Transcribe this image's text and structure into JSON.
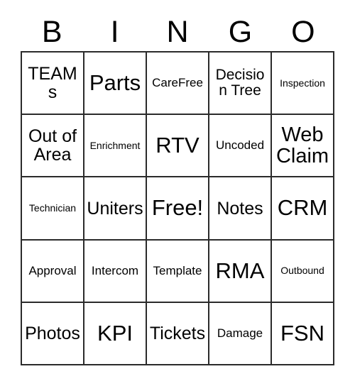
{
  "card": {
    "title": "BINGO",
    "header": {
      "letters": [
        "B",
        "I",
        "N",
        "G",
        "O"
      ]
    },
    "free_space_label": "Free!",
    "colors": {
      "background": "#ffffff",
      "border": "#2b2b2b",
      "text": "#000000"
    },
    "grid": {
      "rows": 5,
      "columns": 5,
      "cells": [
        [
          {
            "label": "TEAMs",
            "size": "l"
          },
          {
            "label": "Parts",
            "size": "xxl"
          },
          {
            "label": "CareFree",
            "size": "s"
          },
          {
            "label": "Decision Tree",
            "size": "m"
          },
          {
            "label": "Inspection",
            "size": "xs"
          }
        ],
        [
          {
            "label": "Out of Area",
            "size": "l"
          },
          {
            "label": "Enrichment",
            "size": "xs"
          },
          {
            "label": "RTV",
            "size": "xxl"
          },
          {
            "label": "Uncoded",
            "size": "s"
          },
          {
            "label": "Web Claim",
            "size": "xl"
          }
        ],
        [
          {
            "label": "Technician",
            "size": "xs"
          },
          {
            "label": "Uniters",
            "size": "l"
          },
          {
            "label": "Free!",
            "size": "xxl"
          },
          {
            "label": "Notes",
            "size": "l"
          },
          {
            "label": "CRM",
            "size": "xxl"
          }
        ],
        [
          {
            "label": "Approval",
            "size": "s"
          },
          {
            "label": "Intercom",
            "size": "s"
          },
          {
            "label": "Template",
            "size": "s"
          },
          {
            "label": "RMA",
            "size": "xxl"
          },
          {
            "label": "Outbound",
            "size": "xs"
          }
        ],
        [
          {
            "label": "Photos",
            "size": "l"
          },
          {
            "label": "KPI",
            "size": "xxl"
          },
          {
            "label": "Tickets",
            "size": "l"
          },
          {
            "label": "Damage",
            "size": "s"
          },
          {
            "label": "FSN",
            "size": "xxl"
          }
        ]
      ]
    }
  }
}
